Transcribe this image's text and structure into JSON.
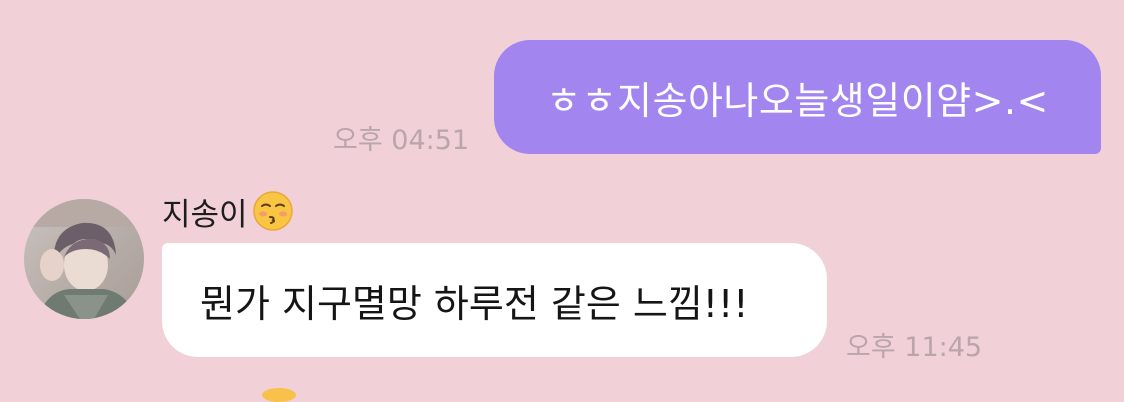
{
  "conversation": {
    "outgoing": {
      "text": "ㅎㅎ지송아나오늘생일이얌>.<",
      "time": "오후 04:51",
      "bubble_color": "#a285ef"
    },
    "incoming": {
      "sender_name": "지송이",
      "sender_emoji": "kissing-face-icon",
      "text": "뭔가 지구멸망 하루전 같은 느낌!!!",
      "time": "오후 11:45",
      "bubble_color": "#ffffff"
    },
    "background_color": "#f1d1d7"
  }
}
